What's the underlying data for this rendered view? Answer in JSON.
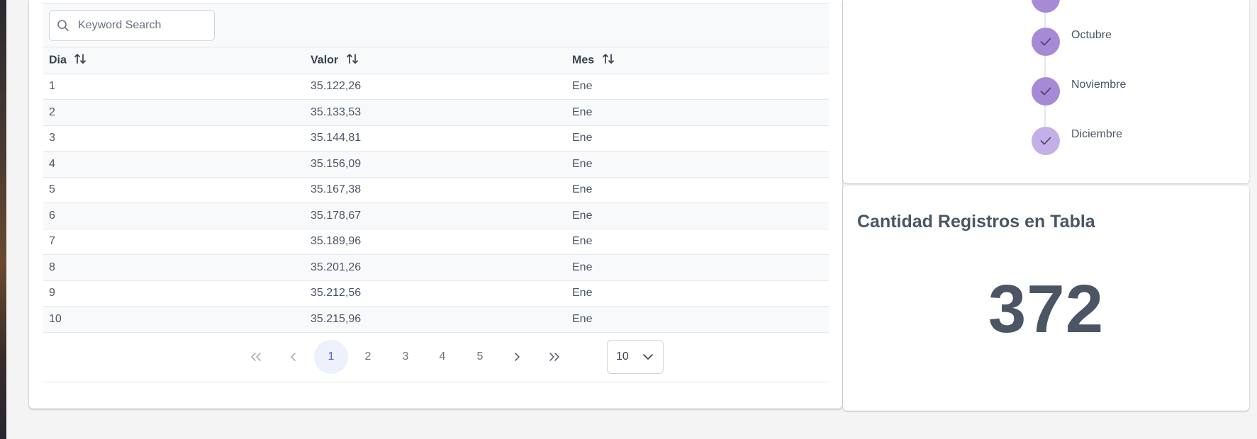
{
  "search": {
    "placeholder": "Keyword Search"
  },
  "table": {
    "columns": [
      "Dia",
      "Valor",
      "Mes"
    ],
    "rows": [
      [
        "1",
        "35.122,26",
        "Ene"
      ],
      [
        "2",
        "35.133,53",
        "Ene"
      ],
      [
        "3",
        "35.144,81",
        "Ene"
      ],
      [
        "4",
        "35.156,09",
        "Ene"
      ],
      [
        "5",
        "35.167,38",
        "Ene"
      ],
      [
        "6",
        "35.178,67",
        "Ene"
      ],
      [
        "7",
        "35.189,96",
        "Ene"
      ],
      [
        "8",
        "35.201,26",
        "Ene"
      ],
      [
        "9",
        "35.212,56",
        "Ene"
      ],
      [
        "10",
        "35.215,96",
        "Ene"
      ]
    ]
  },
  "paginator": {
    "first_icon": "double-chevron-left-icon",
    "prev_icon": "chevron-left-icon",
    "pages": [
      "1",
      "2",
      "3",
      "4",
      "5"
    ],
    "active_page": "1",
    "next_icon": "chevron-right-icon",
    "last_icon": "double-chevron-right-icon",
    "rows_per_page": "10"
  },
  "timeline": {
    "items": [
      {
        "label": "Octubre"
      },
      {
        "label": "Noviembre"
      },
      {
        "label": "Diciembre"
      }
    ],
    "accent": "#a68ad6",
    "accent_light": "#c4b0e8"
  },
  "count_card": {
    "title": "Cantidad Registros en Tabla",
    "value": "372"
  },
  "colors": {
    "active_page_bg": "#eef0fb",
    "active_page_text": "#4f5bd5"
  }
}
